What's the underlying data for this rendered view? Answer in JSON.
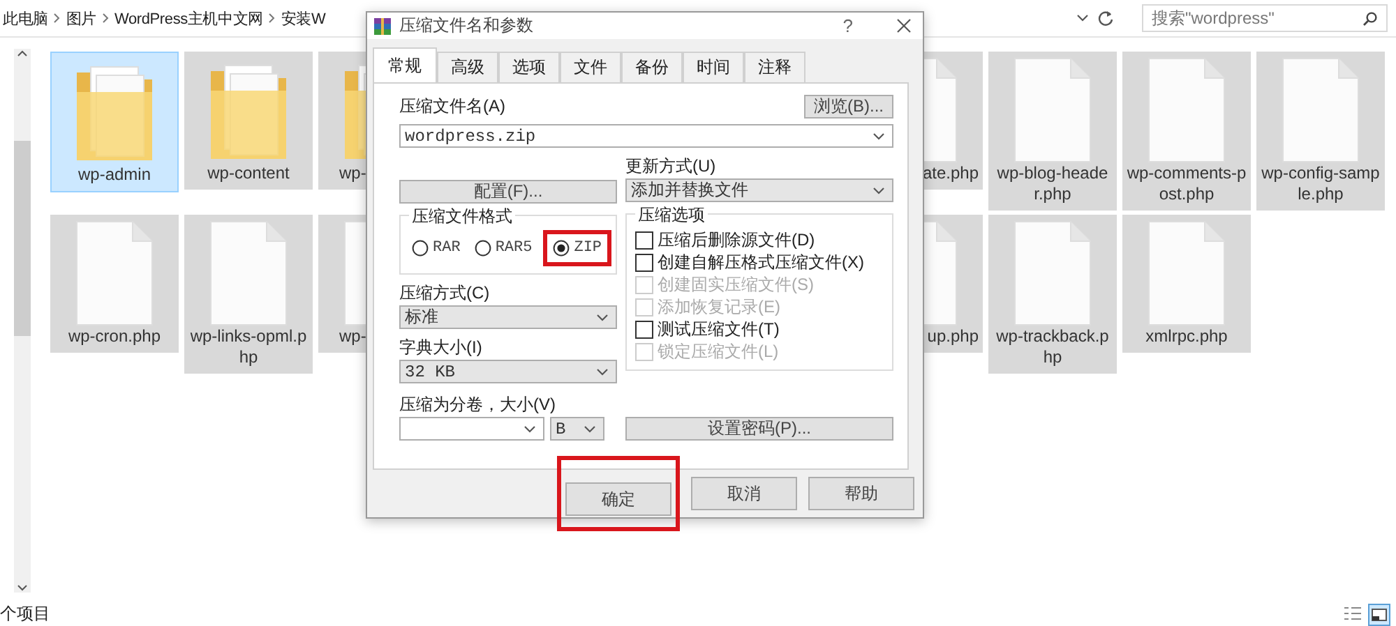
{
  "explorer": {
    "breadcrumb": [
      "此电脑",
      "图片",
      "WordPress主机中文网",
      "安装W"
    ],
    "search": {
      "placeholder": "搜索\"wordpress\""
    },
    "files": [
      [
        {
          "kind": "folder",
          "name": "wp-admin",
          "selected": true
        },
        {
          "kind": "folder",
          "name": "wp-content",
          "selected": false
        },
        {
          "kind": "folder",
          "name": "wp-",
          "selected": false
        },
        {
          "kind": "file",
          "name": "ate.php",
          "selected": false
        },
        {
          "kind": "file",
          "name": "wp-blog-header.php",
          "selected": false
        },
        {
          "kind": "file",
          "name": "wp-comments-post.php",
          "selected": false
        },
        {
          "kind": "file",
          "name": "wp-config-sample.php",
          "selected": false
        }
      ],
      [
        {
          "kind": "file",
          "name": "wp-cron.php",
          "selected": false
        },
        {
          "kind": "file",
          "name": "wp-links-opml.php",
          "selected": false
        },
        {
          "kind": "file",
          "name": "wp-",
          "selected": false
        },
        {
          "kind": "file",
          "name": "up.php",
          "selected": false
        },
        {
          "kind": "file",
          "name": "wp-trackback.php",
          "selected": false
        },
        {
          "kind": "file",
          "name": "xmlrpc.php",
          "selected": false
        }
      ]
    ],
    "status": "个项目"
  },
  "dialog": {
    "title": "压缩文件名和参数",
    "help": "?",
    "tabs": [
      {
        "label": "常规",
        "selected": true
      },
      {
        "label": "高级",
        "selected": false
      },
      {
        "label": "选项",
        "selected": false
      },
      {
        "label": "文件",
        "selected": false
      },
      {
        "label": "备份",
        "selected": false
      },
      {
        "label": "时间",
        "selected": false
      },
      {
        "label": "注释",
        "selected": false
      }
    ],
    "archive_name": {
      "label": "压缩文件名(A)",
      "value": "wordpress.zip"
    },
    "browse_button": "浏览(B)...",
    "profiles_button": "配置(F)...",
    "update_mode": {
      "label": "更新方式(U)",
      "value": "添加并替换文件"
    },
    "archive_format": {
      "title": "压缩文件格式",
      "options": [
        {
          "label": "RAR",
          "selected": false,
          "highlighted": false
        },
        {
          "label": "RAR5",
          "selected": false,
          "highlighted": false
        },
        {
          "label": "ZIP",
          "selected": true,
          "highlighted": true
        }
      ]
    },
    "compression_method": {
      "label": "压缩方式(C)",
      "value": "标准"
    },
    "dictionary_size": {
      "label": "字典大小(I)",
      "value": "32 KB"
    },
    "split_volumes": {
      "label": "压缩为分卷，大小(V)",
      "unit": "B"
    },
    "archiving_options": {
      "title": "压缩选项",
      "options": [
        {
          "label": "压缩后删除源文件(D)",
          "checked": false,
          "disabled": false
        },
        {
          "label": "创建自解压格式压缩文件(X)",
          "checked": false,
          "disabled": false
        },
        {
          "label": "创建固实压缩文件(S)",
          "checked": false,
          "disabled": true
        },
        {
          "label": "添加恢复记录(E)",
          "checked": false,
          "disabled": true
        },
        {
          "label": "测试压缩文件(T)",
          "checked": false,
          "disabled": false
        },
        {
          "label": "锁定压缩文件(L)",
          "checked": false,
          "disabled": true
        }
      ]
    },
    "password_button": "设置密码(P)...",
    "buttons": [
      {
        "label": "确定",
        "highlighted": true
      },
      {
        "label": "取消",
        "highlighted": false
      },
      {
        "label": "帮助",
        "highlighted": false
      }
    ]
  }
}
